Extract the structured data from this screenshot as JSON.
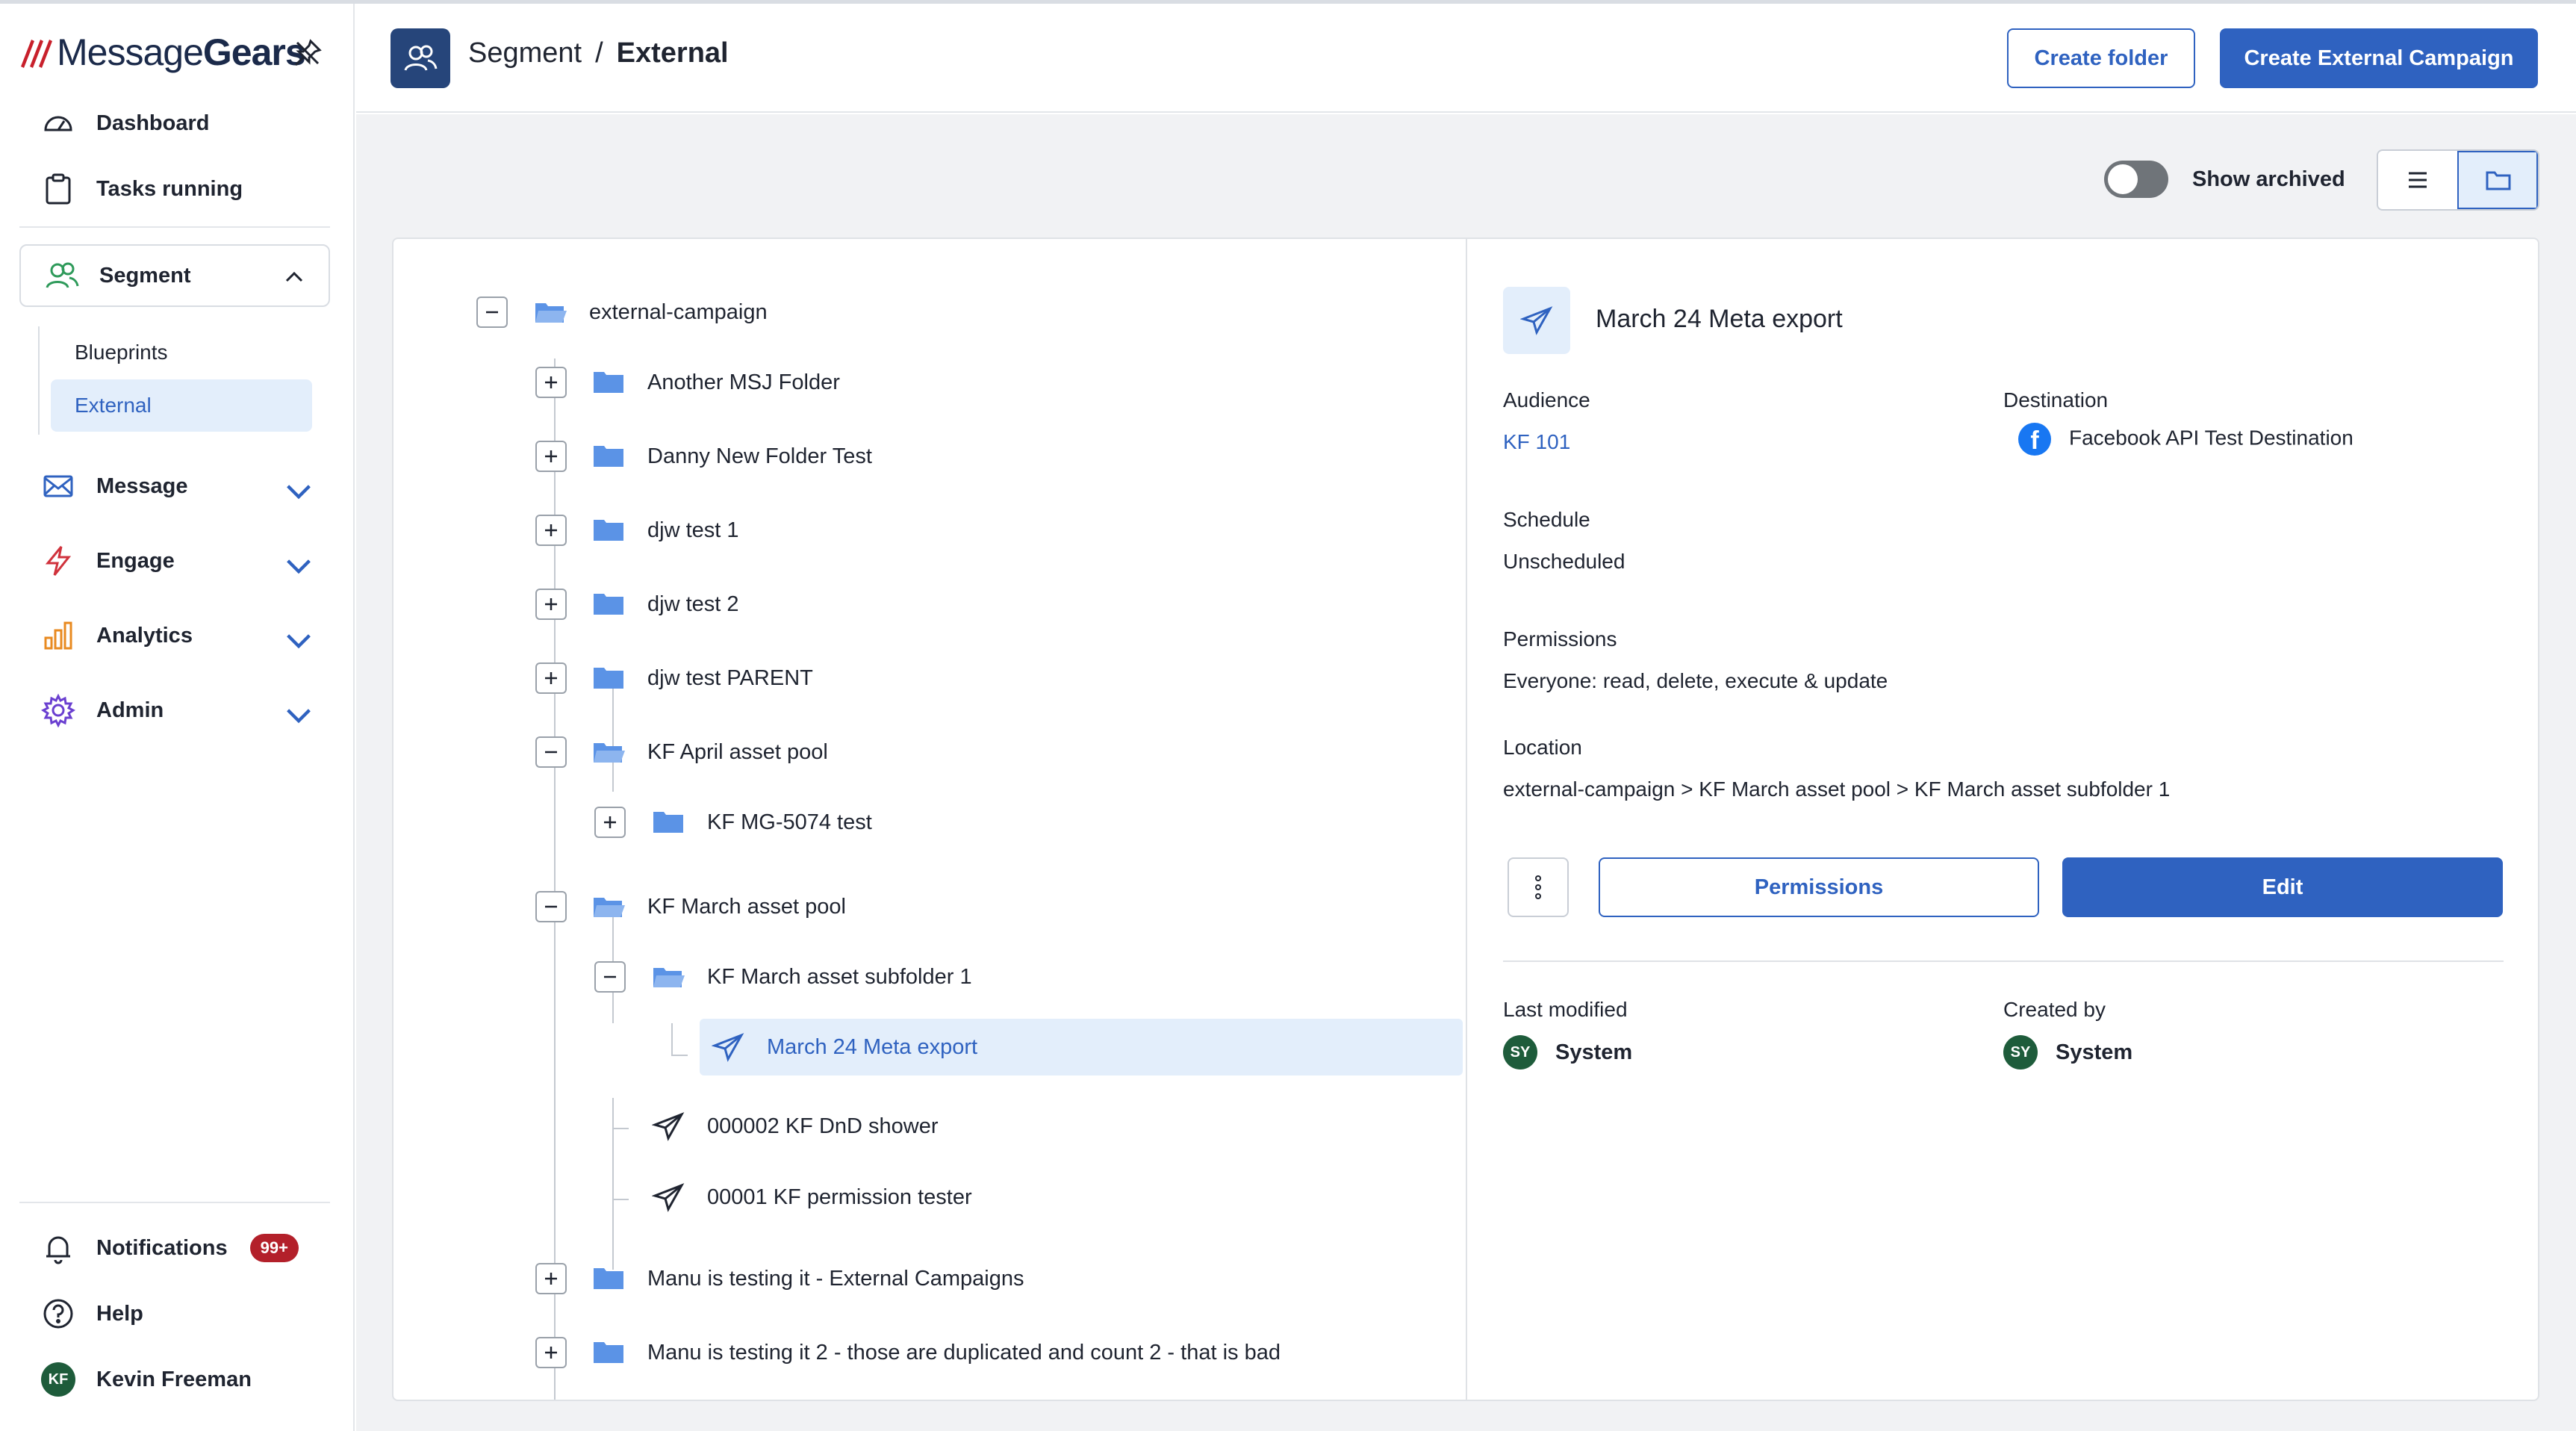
{
  "brand": {
    "name_light": "Message",
    "name_bold": "Gears"
  },
  "sidebar": {
    "dashboard": "Dashboard",
    "tasks_running": "Tasks running",
    "segment": "Segment",
    "segment_sub": [
      {
        "label": "Blueprints",
        "active": false
      },
      {
        "label": "External",
        "active": true
      }
    ],
    "message": "Message",
    "engage": "Engage",
    "analytics": "Analytics",
    "admin": "Admin",
    "notifications": "Notifications",
    "notifications_badge": "99+",
    "help": "Help",
    "user_name": "Kevin Freeman",
    "user_initials": "KF"
  },
  "header": {
    "crumb_root": "Segment",
    "crumb_sep": "/",
    "crumb_current": "External",
    "create_folder": "Create folder",
    "create_campaign": "Create External Campaign"
  },
  "toolbar": {
    "show_archived": "Show archived",
    "show_archived_on": false,
    "view_mode": "folder"
  },
  "tree": {
    "root": "external-campaign",
    "items": {
      "f1": "Another MSJ Folder",
      "f2": "Danny New Folder Test",
      "f3": "djw test 1",
      "f4": "djw test 2",
      "f5": "djw test PARENT",
      "f6": "KF April asset pool",
      "f6a": "KF MG-5074 test",
      "f7": "KF March asset pool",
      "f7a": "KF March asset subfolder 1",
      "f7a1": "March 24 Meta export",
      "c1": "000002 KF DnD shower",
      "c2": "00001 KF permission tester",
      "f8": "Manu is testing it - External Campaigns",
      "f9": "Manu is testing it 2 - those are duplicated and count 2 - that is bad"
    }
  },
  "detail": {
    "title": "March 24 Meta export",
    "audience_label": "Audience",
    "audience_value": "KF 101",
    "destination_label": "Destination",
    "destination_value": "Facebook API Test Destination",
    "schedule_label": "Schedule",
    "schedule_value": "Unscheduled",
    "permissions_label": "Permissions",
    "permissions_value": "Everyone: read, delete, execute & update",
    "location_label": "Location",
    "location_value": "external-campaign > KF March asset pool > KF March asset subfolder 1",
    "permissions_button": "Permissions",
    "edit_button": "Edit",
    "last_modified_label": "Last modified",
    "last_modified_by": "System",
    "last_modified_initials": "SY",
    "created_by_label": "Created by",
    "created_by": "System",
    "created_by_initials": "SY"
  },
  "colors": {
    "accent": "#2f62c0",
    "brand_dark": "#26457a",
    "selected_bg": "#e3eefb",
    "folder": "#5b93e6",
    "badge": "#b3202a",
    "avatar": "#1e5c3b"
  }
}
